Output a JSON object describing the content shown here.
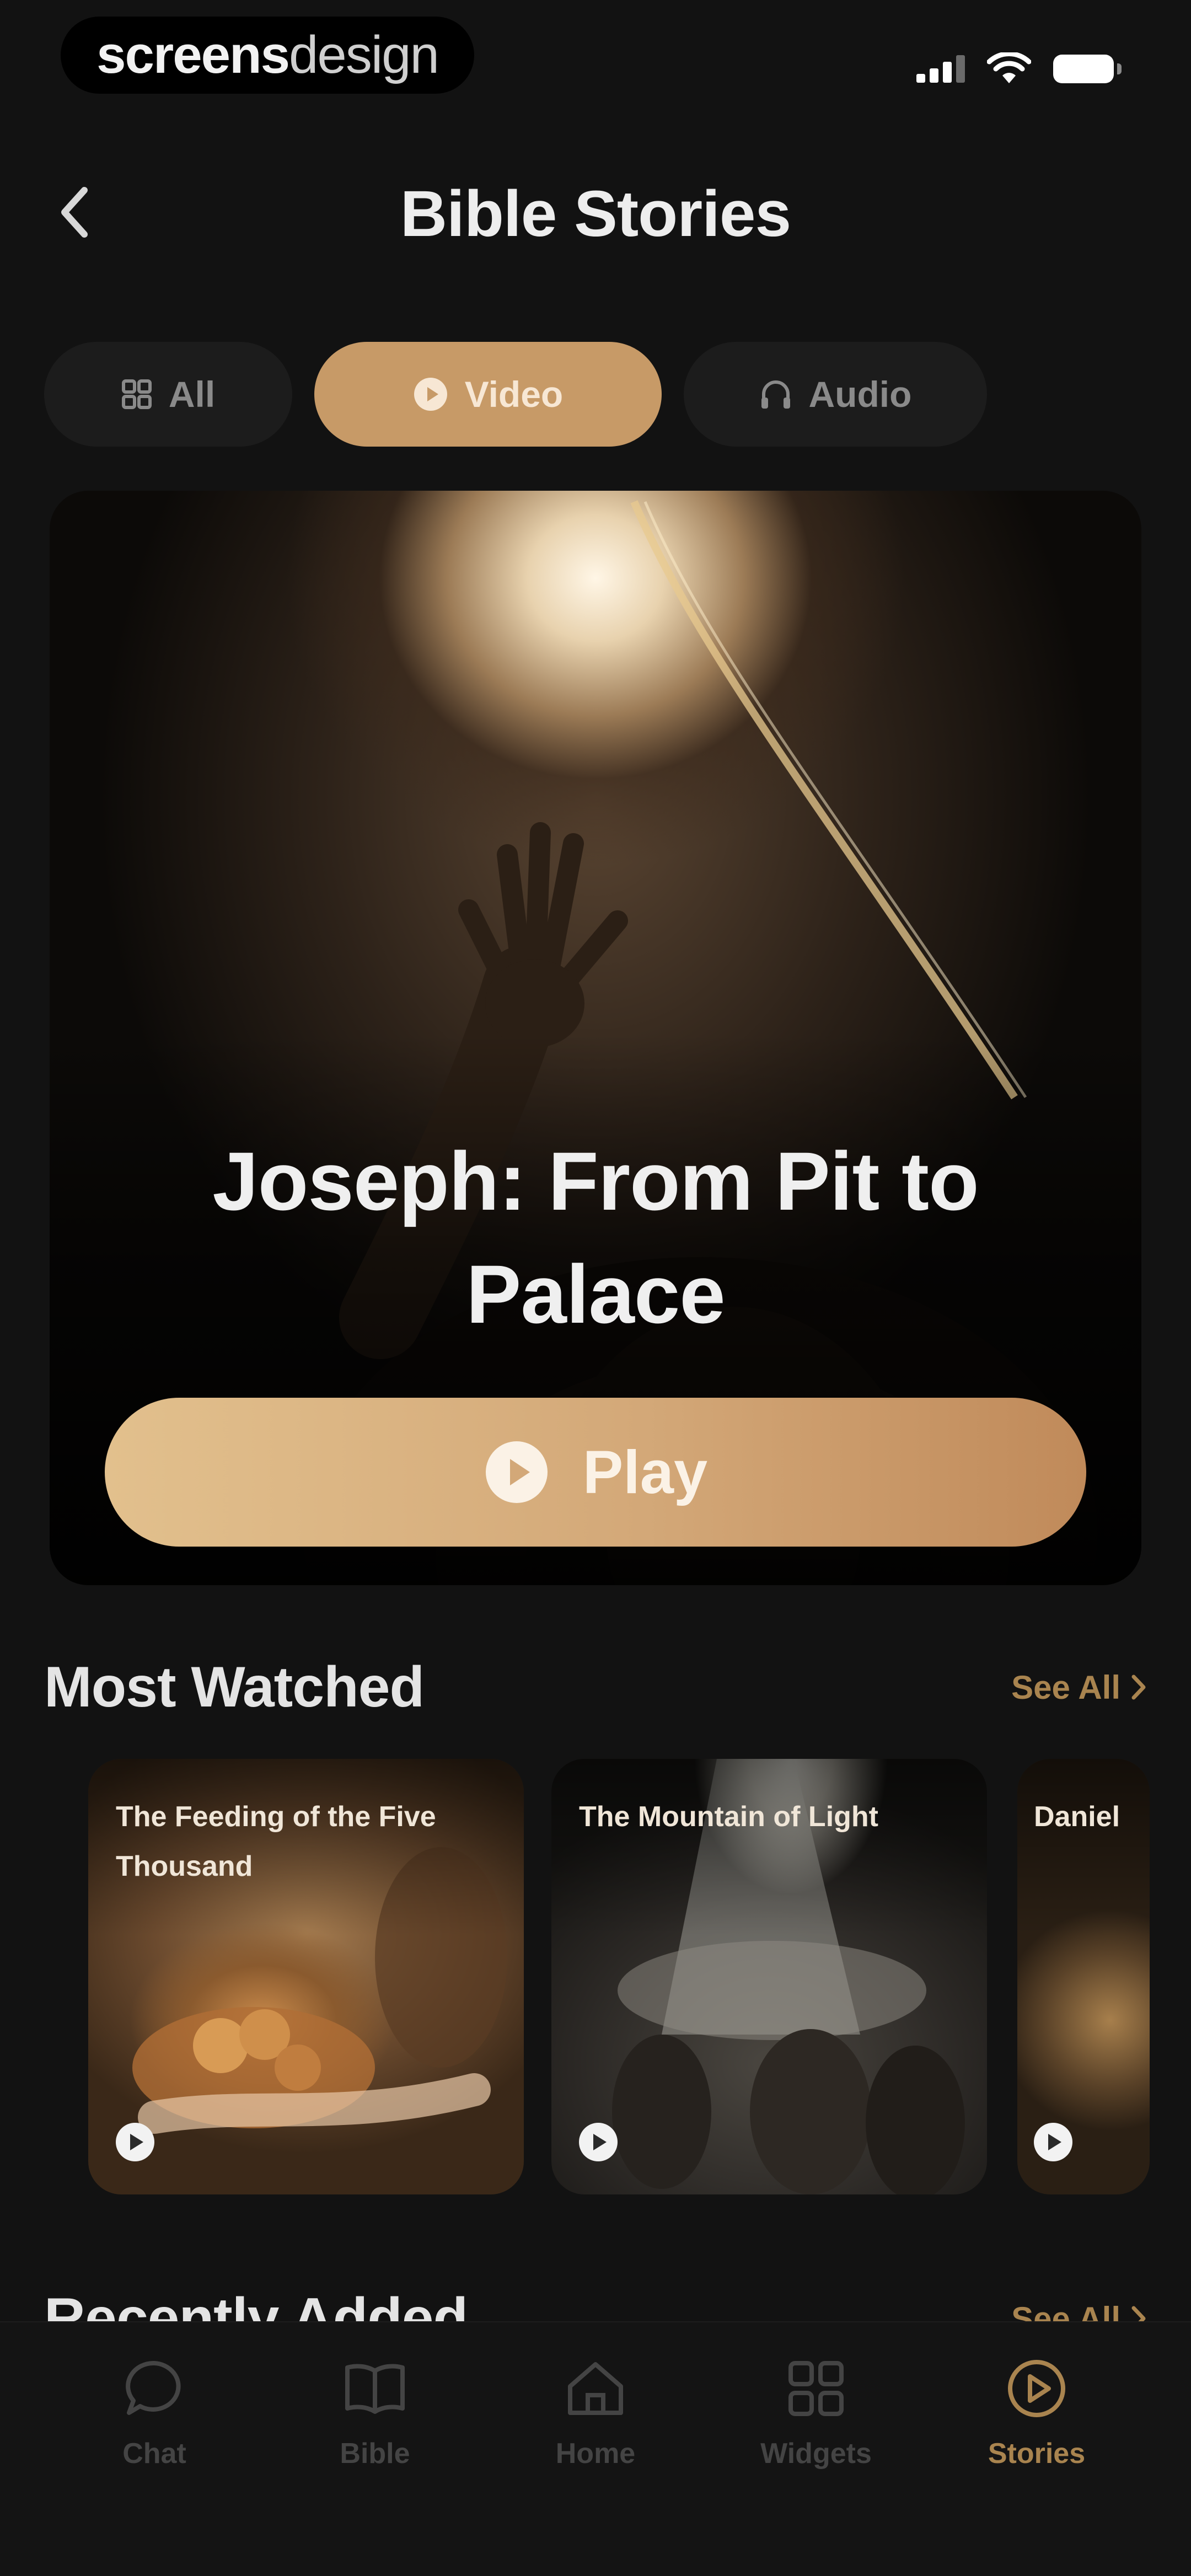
{
  "status_bar": {
    "brand_bold": "screens",
    "brand_light": "design"
  },
  "header": {
    "title": "Bible Stories"
  },
  "filters": [
    {
      "label": "All",
      "icon": "grid-icon"
    },
    {
      "label": "Video",
      "icon": "play-circle-icon",
      "active": true
    },
    {
      "label": "Audio",
      "icon": "headphones-icon"
    }
  ],
  "hero": {
    "title": "Joseph: From Pit to Palace",
    "play_label": "Play"
  },
  "most_watched": {
    "title": "Most Watched",
    "see_all": "See All",
    "items": [
      {
        "title": "The Feeding of the Five Thousand"
      },
      {
        "title": "The Mountain of Light"
      },
      {
        "title": "Daniel"
      }
    ]
  },
  "recently_added": {
    "title": "Recently Added",
    "see_all": "See All"
  },
  "tab_bar": {
    "tabs": [
      {
        "label": "Chat",
        "icon": "chat-icon"
      },
      {
        "label": "Bible",
        "icon": "book-icon"
      },
      {
        "label": "Home",
        "icon": "home-icon"
      },
      {
        "label": "Widgets",
        "icon": "widgets-icon"
      },
      {
        "label": "Stories",
        "icon": "play-circle-icon",
        "active": true
      }
    ]
  },
  "colors": {
    "accent": "#c79a67",
    "accent_text": "#a9844f",
    "background": "#121212"
  }
}
